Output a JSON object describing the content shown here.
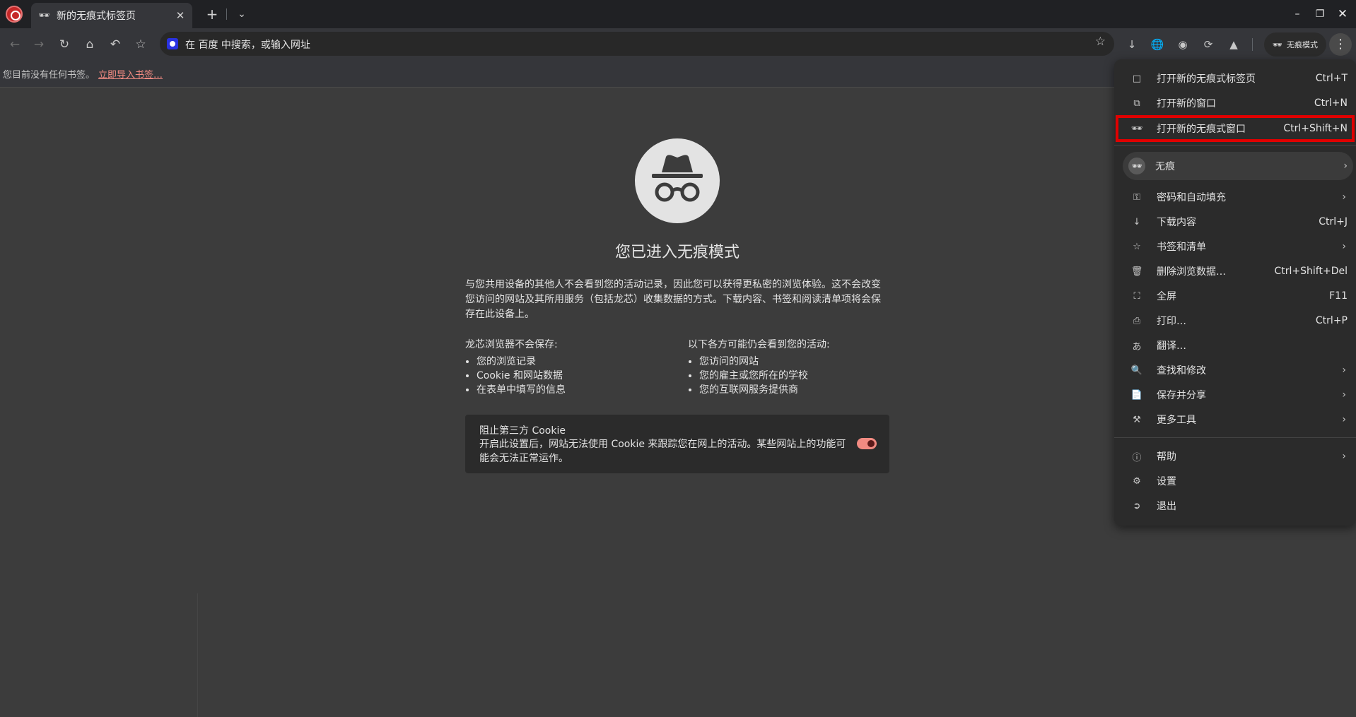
{
  "tab": {
    "title": "新的无痕式标签页",
    "icon": "incognito-icon"
  },
  "window_controls": {
    "minimize": "–",
    "maximize": "❐",
    "close": "✕"
  },
  "toolbar": {
    "omnibox_placeholder": "在 百度 中搜索，或输入网址",
    "incognito_chip": "无痕模式"
  },
  "bookmarks_bar": {
    "empty_text": "您目前没有任何书签。",
    "import_link": "立即导入书签…"
  },
  "content": {
    "title": "您已进入无痕模式",
    "description": "与您共用设备的其他人不会看到您的活动记录，因此您可以获得更私密的浏览体验。这不会改变您访问的网站及其所用服务（包括龙芯）收集数据的方式。下载内容、书签和阅读清单项将会保存在此设备上。",
    "not_saved": {
      "heading": "龙芯浏览器不会保存:",
      "items": [
        "您的浏览记录",
        "Cookie 和网站数据",
        "在表单中填写的信息"
      ]
    },
    "may_see": {
      "heading": "以下各方可能仍会看到您的活动:",
      "items": [
        "您访问的网站",
        "您的雇主或您所在的学校",
        "您的互联网服务提供商"
      ]
    },
    "cookie_card": {
      "title": "阻止第三方 Cookie",
      "description": "开启此设置后，网站无法使用 Cookie 来跟踪您在网上的活动。某些网站上的功能可能会无法正常运作。",
      "toggle_on": true
    }
  },
  "menu": {
    "items": [
      {
        "label": "打开新的无痕式标签页",
        "shortcut": "Ctrl+T"
      },
      {
        "label": "打开新的窗口",
        "shortcut": "Ctrl+N"
      },
      {
        "label": "打开新的无痕式窗口",
        "shortcut": "Ctrl+Shift+N"
      },
      {
        "label": "无痕"
      },
      {
        "label": "密码和自动填充"
      },
      {
        "label": "下载内容",
        "shortcut": "Ctrl+J"
      },
      {
        "label": "书签和清单"
      },
      {
        "label": "删除浏览数据…",
        "shortcut": "Ctrl+Shift+Del"
      },
      {
        "label": "全屏",
        "shortcut": "F11"
      },
      {
        "label": "打印…",
        "shortcut": "Ctrl+P"
      },
      {
        "label": "翻译…"
      },
      {
        "label": "查找和修改"
      },
      {
        "label": "保存并分享"
      },
      {
        "label": "更多工具"
      },
      {
        "label": "帮助"
      },
      {
        "label": "设置"
      },
      {
        "label": "退出"
      }
    ]
  },
  "colors": {
    "highlight_border": "#e00000",
    "link": "#f28b82",
    "background": "#3c3c3c"
  }
}
